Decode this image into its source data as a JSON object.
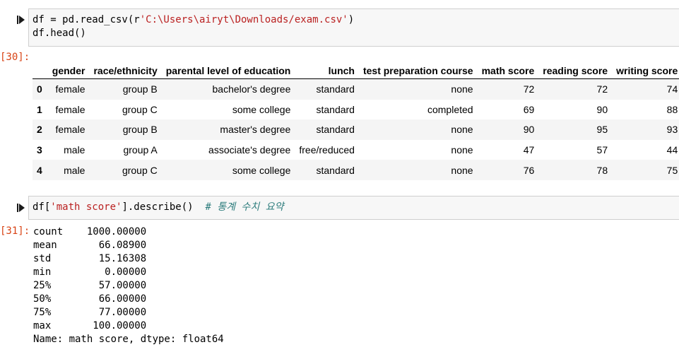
{
  "cell30": {
    "prompt": "[30]:",
    "code_line1_pre": "df = pd.read_csv(r",
    "code_line1_str": "'C:\\Users\\airyt\\Downloads/exam.csv'",
    "code_line1_post": ")",
    "code_line2": "df.head()"
  },
  "table": {
    "columns": [
      "",
      "gender",
      "race/ethnicity",
      "parental level of education",
      "lunch",
      "test preparation course",
      "math score",
      "reading score",
      "writing score"
    ],
    "rows": [
      [
        "0",
        "female",
        "group B",
        "bachelor's degree",
        "standard",
        "none",
        "72",
        "72",
        "74"
      ],
      [
        "1",
        "female",
        "group C",
        "some college",
        "standard",
        "completed",
        "69",
        "90",
        "88"
      ],
      [
        "2",
        "female",
        "group B",
        "master's degree",
        "standard",
        "none",
        "90",
        "95",
        "93"
      ],
      [
        "3",
        "male",
        "group A",
        "associate's degree",
        "free/reduced",
        "none",
        "47",
        "57",
        "44"
      ],
      [
        "4",
        "male",
        "group C",
        "some college",
        "standard",
        "none",
        "76",
        "78",
        "75"
      ]
    ]
  },
  "cell31": {
    "prompt": "[31]:",
    "code_pre": "df[",
    "code_str": "'math score'",
    "code_post": "].describe()  ",
    "comment": "# 통계 수치 요약",
    "output_lines": [
      "count    1000.00000",
      "mean       66.08900",
      "std        15.16308",
      "min         0.00000",
      "25%        57.00000",
      "50%        66.00000",
      "75%        77.00000",
      "max       100.00000",
      "Name: math score, dtype: float64"
    ]
  }
}
